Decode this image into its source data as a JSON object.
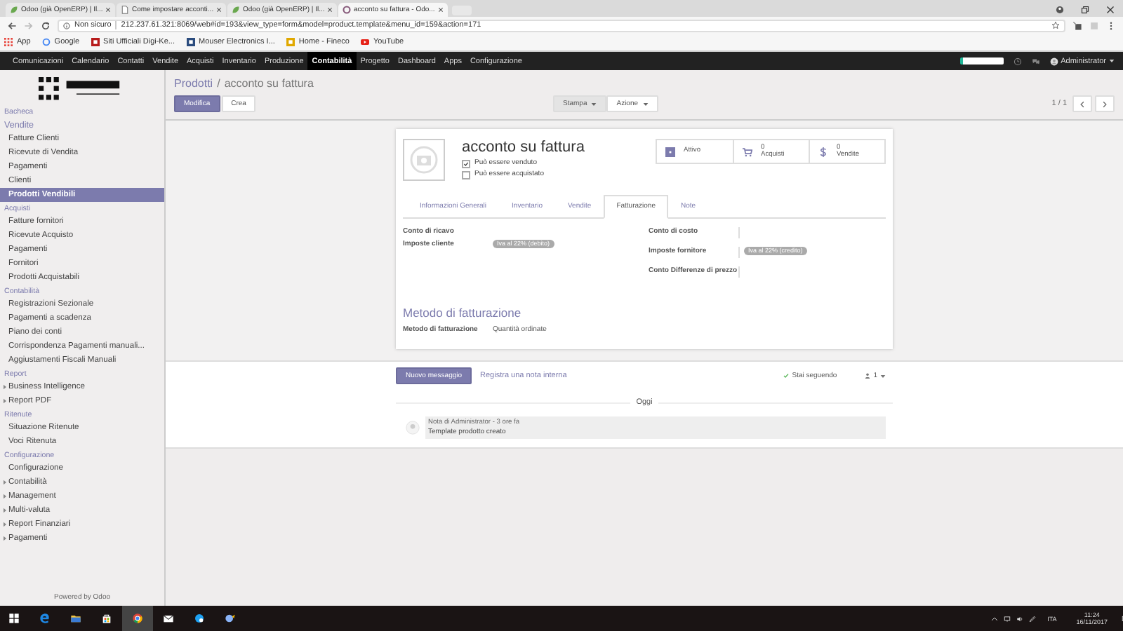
{
  "browser": {
    "tabs": [
      {
        "kind": "leaf",
        "title": "Odoo (già OpenERP) | Il...",
        "selected": false
      },
      {
        "kind": "page",
        "title": "Come impostare acconti...",
        "selected": false
      },
      {
        "kind": "leaf",
        "title": "Odoo (già OpenERP) | Il...",
        "selected": false
      },
      {
        "kind": "ring",
        "title": "acconto su fattura - Odo...",
        "selected": true
      }
    ],
    "security": "Non sicuro",
    "url": "212.237.61.321:8069/web#id=193&view_type=form&model=product.template&menu_id=159&action=171",
    "bookmarks": [
      {
        "kind": "apps",
        "label": "App"
      },
      {
        "kind": "google",
        "label": "Google"
      },
      {
        "kind": "flag",
        "label": "Siti Ufficiali Digi-Ke..."
      },
      {
        "kind": "letter",
        "label": "Mouser Electronics I..."
      },
      {
        "kind": "bank",
        "label": "Home - Fineco"
      },
      {
        "kind": "youtube",
        "label": "YouTube"
      }
    ]
  },
  "topbar": {
    "menu": [
      {
        "label": "Comunicazioni",
        "selected": false
      },
      {
        "label": "Calendario",
        "selected": false
      },
      {
        "label": "Contatti",
        "selected": false
      },
      {
        "label": "Vendite",
        "selected": false
      },
      {
        "label": "Acquisti",
        "selected": false
      },
      {
        "label": "Inventario",
        "selected": false
      },
      {
        "label": "Produzione",
        "selected": false
      },
      {
        "label": "Contabilità",
        "selected": true
      },
      {
        "label": "Progetto",
        "selected": false
      },
      {
        "label": "Dashboard",
        "selected": false
      },
      {
        "label": "Apps",
        "selected": false
      },
      {
        "label": "Configurazione",
        "selected": false
      }
    ],
    "user": "Administrator"
  },
  "sidebar": {
    "sections": [
      {
        "title": "Bacheca"
      },
      {
        "title": "Vendite",
        "items": [
          {
            "label": "Fatture Clienti",
            "selected": false,
            "expandable": false
          },
          {
            "label": "Ricevute di Vendita",
            "selected": false,
            "expandable": false
          },
          {
            "label": "Pagamenti",
            "selected": false,
            "expandable": false
          },
          {
            "label": "Clienti",
            "selected": false,
            "expandable": false
          },
          {
            "label": "Prodotti Vendibili",
            "selected": true,
            "expandable": false
          }
        ]
      },
      {
        "title": "Acquisti",
        "items": [
          {
            "label": "Fatture fornitori",
            "selected": false,
            "expandable": false
          },
          {
            "label": "Ricevute Acquisto",
            "selected": false,
            "expandable": false
          },
          {
            "label": "Pagamenti",
            "selected": false,
            "expandable": false
          },
          {
            "label": "Fornitori",
            "selected": false,
            "expandable": false
          },
          {
            "label": "Prodotti Acquistabili",
            "selected": false,
            "expandable": false
          }
        ]
      },
      {
        "title": "Contabilità",
        "items": [
          {
            "label": "Registrazioni Sezionale",
            "selected": false,
            "expandable": false
          },
          {
            "label": "Pagamenti a scadenza",
            "selected": false,
            "expandable": false
          },
          {
            "label": "Piano dei conti",
            "selected": false,
            "expandable": false
          },
          {
            "label": "Corrispondenza Pagamenti manuali...",
            "selected": false,
            "expandable": false
          },
          {
            "label": "Aggiustamenti Fiscali Manuali",
            "selected": false,
            "expandable": false
          }
        ]
      },
      {
        "title": "Report",
        "items": [
          {
            "label": "Business Intelligence",
            "selected": false,
            "expandable": true
          },
          {
            "label": "Report PDF",
            "selected": false,
            "expandable": true
          }
        ]
      },
      {
        "title": "Ritenute",
        "items": [
          {
            "label": "Situazione Ritenute",
            "selected": false,
            "expandable": false
          },
          {
            "label": "Voci Ritenuta",
            "selected": false,
            "expandable": false
          }
        ]
      },
      {
        "title": "Configurazione",
        "items": [
          {
            "label": "Configurazione",
            "selected": false,
            "expandable": false
          },
          {
            "label": "Contabilità",
            "selected": false,
            "expandable": true
          },
          {
            "label": "Management",
            "selected": false,
            "expandable": true
          },
          {
            "label": "Multi-valuta",
            "selected": false,
            "expandable": true
          },
          {
            "label": "Report Finanziari",
            "selected": false,
            "expandable": true
          },
          {
            "label": "Pagamenti",
            "selected": false,
            "expandable": true
          }
        ]
      }
    ],
    "footer": "Powered by Odoo"
  },
  "control_panel": {
    "breadcrumb": {
      "parent": "Prodotti",
      "separator": "/",
      "current": "acconto su fattura"
    },
    "edit_button": "Modifica",
    "create_button": "Crea",
    "dropdowns": [
      "Stampa",
      "Azione"
    ],
    "pager": "1 / 1"
  },
  "form": {
    "title": "acconto su fattura",
    "checkboxes": [
      {
        "label": "Può essere venduto",
        "checked": true
      },
      {
        "label": "Può essere acquistato",
        "checked": false
      }
    ],
    "stat_buttons": [
      {
        "kind": "toggle",
        "label": "Attivo"
      },
      {
        "kind": "cart",
        "value": "0",
        "label": "Acquisti"
      },
      {
        "kind": "dollar",
        "value": "0",
        "label": "Vendite"
      }
    ],
    "tabs": [
      {
        "label": "Informazioni Generali",
        "selected": false
      },
      {
        "label": "Inventario",
        "selected": false
      },
      {
        "label": "Vendite",
        "selected": false
      },
      {
        "label": "Fatturazione",
        "selected": true
      },
      {
        "label": "Note",
        "selected": false
      }
    ],
    "left_fields": [
      {
        "label": "Conto di ricavo"
      },
      {
        "label": "Imposte cliente",
        "tag": "Iva al 22% (debito)"
      }
    ],
    "right_fields": [
      {
        "label": "Conto di costo"
      },
      {
        "label": "Imposte fornitore",
        "tag": "Iva al 22% (credito)"
      },
      {
        "label": "Conto Differenze di prezzo"
      }
    ],
    "section_title": "Metodo di fatturazione",
    "section_fields": [
      {
        "label": "Metodo di fatturazione",
        "value": "Quantità ordinate"
      }
    ]
  },
  "chatter": {
    "new_message": "Nuovo messaggio",
    "log_note": "Registra una nota interna",
    "following": "Stai seguendo",
    "followers": "1",
    "divider": "Oggi",
    "messages": [
      {
        "author": "Nota di Administrator - 3 ore fa",
        "body": "Template prodotto creato"
      }
    ]
  },
  "taskbar": {
    "language": "ITA",
    "time": "11:24",
    "date": "16/11/2017"
  }
}
